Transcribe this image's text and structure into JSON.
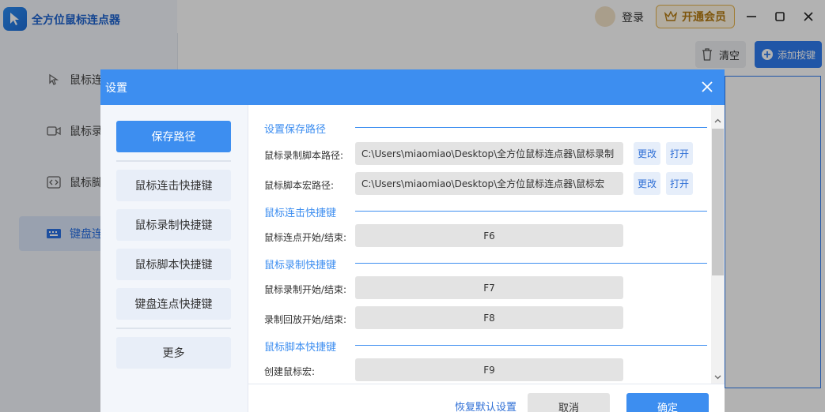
{
  "app": {
    "title": "全方位鼠标连点器",
    "sidebar": {
      "items": [
        {
          "label": "鼠标连"
        },
        {
          "label": "鼠标录"
        },
        {
          "label": "鼠标脚"
        },
        {
          "label": "键盘连"
        }
      ]
    },
    "topbar": {
      "login": "登录",
      "vip": "开通会员"
    },
    "toolbar": {
      "clear": "清空",
      "add_key": "添加按键"
    }
  },
  "dialog": {
    "title": "设置",
    "nav": [
      {
        "label": "保存路径"
      },
      {
        "label": "鼠标连击快捷键"
      },
      {
        "label": "鼠标录制快捷键"
      },
      {
        "label": "鼠标脚本快捷键"
      },
      {
        "label": "键盘连点快捷键"
      },
      {
        "label": "更多"
      }
    ],
    "sections": {
      "save_path": {
        "title": "设置保存路径",
        "rows": [
          {
            "label": "鼠标录制脚本路径:",
            "value": "C:\\Users\\miaomiao\\Desktop\\全方位鼠标连点器\\鼠标录制",
            "change": "更改",
            "open": "打开"
          },
          {
            "label": "鼠标脚本宏路径:",
            "value": "C:\\Users\\miaomiao\\Desktop\\全方位鼠标连点器\\鼠标宏",
            "change": "更改",
            "open": "打开"
          }
        ]
      },
      "click_hotkey": {
        "title": "鼠标连击快捷键",
        "rows": [
          {
            "label": "鼠标连点开始/结束:",
            "value": "F6"
          }
        ]
      },
      "record_hotkey": {
        "title": "鼠标录制快捷键",
        "rows": [
          {
            "label": "鼠标录制开始/结束:",
            "value": "F7"
          },
          {
            "label": "录制回放开始/结束:",
            "value": "F8"
          }
        ]
      },
      "script_hotkey": {
        "title": "鼠标脚本快捷键",
        "rows": [
          {
            "label": "创建鼠标宏:",
            "value": "F9"
          }
        ]
      }
    },
    "footer": {
      "restore": "恢复默认设置",
      "cancel": "取消",
      "ok": "确定"
    }
  },
  "colors": {
    "accent": "#3d8ef0",
    "vip_gold": "#e6b34c"
  },
  "icons": [
    "app-logo-icon",
    "mouse-icon",
    "video-icon",
    "code-icon",
    "keyboard-icon",
    "crown-icon",
    "minimize-icon",
    "maximize-icon",
    "close-icon",
    "trash-icon",
    "plus-circle-icon"
  ]
}
